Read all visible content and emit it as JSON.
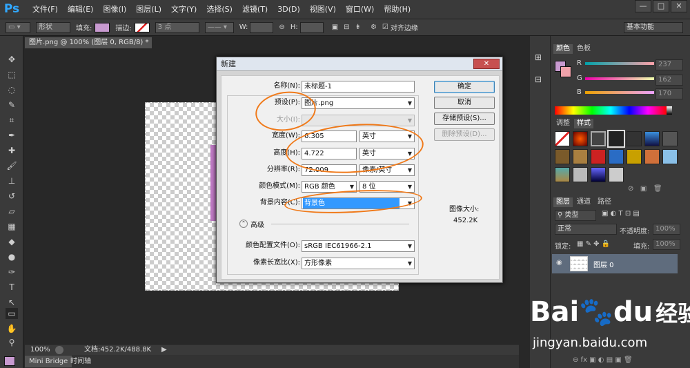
{
  "app": {
    "logo": "Ps"
  },
  "menu": [
    "文件(F)",
    "编辑(E)",
    "图像(I)",
    "图层(L)",
    "文字(Y)",
    "选择(S)",
    "滤镜(T)",
    "3D(D)",
    "视图(V)",
    "窗口(W)",
    "帮助(H)"
  ],
  "window_buttons": [
    "—",
    "□",
    "✕"
  ],
  "options": {
    "shape_mode": "形状",
    "fill_label": "填充:",
    "stroke_label": "描边:",
    "stroke_width": "3 点",
    "w_label": "W:",
    "h_label": "H:",
    "align_edges": "对齐边缘",
    "workspace": "基本功能",
    "fill_color": "#c89ad0"
  },
  "document": {
    "tab": "图片.png @ 100% (图层 0, RGB/8) *",
    "tab_close": "×"
  },
  "status": {
    "zoom": "100%",
    "doc_info": "文档:452.2K/488.8K"
  },
  "bottom_tabs": [
    "Mini Bridge",
    "时间轴"
  ],
  "color_panel": {
    "tabs": [
      "颜色",
      "色板"
    ],
    "r_label": "R",
    "g_label": "G",
    "b_label": "B",
    "r": "237",
    "g": "162",
    "b": "170"
  },
  "styles_panel": {
    "tabs": [
      "调整",
      "样式"
    ]
  },
  "layers_panel": {
    "tabs": [
      "图层",
      "通道",
      "路径"
    ],
    "kind": "类型",
    "blend": "正常",
    "opacity_label": "不透明度:",
    "opacity": "100%",
    "lock_label": "锁定:",
    "fill_label": "填充:",
    "fill": "100%",
    "layer_name": "图层 0"
  },
  "dialog": {
    "title": "新建",
    "close": "✕",
    "name_label": "名称(N):",
    "name_value": "未标题-1",
    "preset_label": "预设(P):",
    "preset_value": "图片.png",
    "size_label": "大小(I):",
    "width_label": "宽度(W):",
    "width_value": "6.305",
    "width_unit": "英寸",
    "height_label": "高度(H):",
    "height_value": "4.722",
    "height_unit": "英寸",
    "res_label": "分辨率(R):",
    "res_value": "72.009",
    "res_unit": "像素/英寸",
    "mode_label": "颜色模式(M):",
    "mode_value": "RGB 颜色",
    "bits_value": "8 位",
    "bg_label": "背景内容(C):",
    "bg_value": "背景色",
    "advanced": "高级",
    "profile_label": "颜色配置文件(O):",
    "profile_value": "sRGB IEC61966-2.1",
    "aspect_label": "像素长宽比(X):",
    "aspect_value": "方形像素",
    "ok": "确定",
    "cancel": "取消",
    "save_preset": "存储预设(S)...",
    "delete_preset": "删除预设(D)...",
    "image_size_label": "图像大小:",
    "image_size_value": "452.2K"
  },
  "watermark": {
    "brand_left": "Bai",
    "brand_right": "du",
    "brand_cn": "经验",
    "url": "jingyan.baidu.com"
  }
}
